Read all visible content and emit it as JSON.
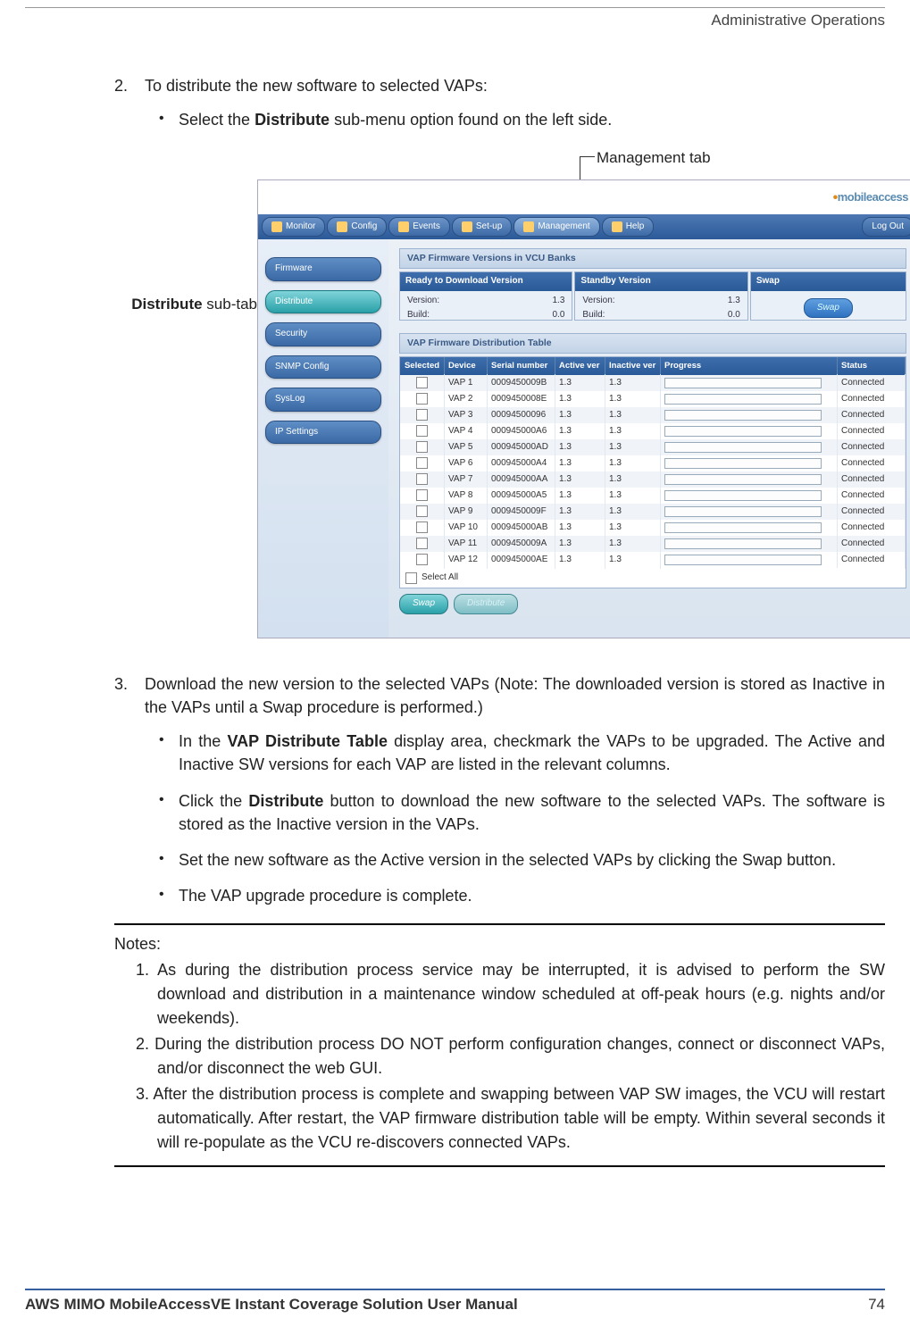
{
  "header": {
    "section": "Administrative Operations"
  },
  "steps": {
    "s2_num": "2.",
    "s2_text": "To distribute the new software to selected VAPs:",
    "s2_b1_pre": "Select the ",
    "s2_b1_bold": "Distribute",
    "s2_b1_post": " sub-menu option found on the left side.",
    "s3_num": "3.",
    "s3_text": "Download the new version to the selected VAPs (Note: The downloaded version is stored as Inactive in the VAPs until a Swap procedure is performed.)",
    "s3_b1_pre": "In the ",
    "s3_b1_bold": "VAP Distribute Table",
    "s3_b1_post": " display area, checkmark the VAPs to be upgraded.  The Active and Inactive SW versions for each VAP are listed in the relevant columns.",
    "s3_b2_pre": "Click the ",
    "s3_b2_bold": "Distribute",
    "s3_b2_post": " button to download the new software to the selected VAPs. The software is stored as the Inactive version in the VAPs.",
    "s3_b3": "Set the new software as the Active version in the selected VAPs by clicking the Swap button.",
    "s3_b4": "The VAP upgrade procedure is complete."
  },
  "callouts": {
    "management": "Management tab",
    "distribute_pre": "Distribute",
    "distribute_post": " sub-tab"
  },
  "screenshot": {
    "logo": "mobileaccess",
    "menu": [
      "Monitor",
      "Config",
      "Events",
      "Set-up",
      "Management",
      "Help"
    ],
    "logout": "Log Out",
    "sidebar": [
      "Firmware",
      "Distribute",
      "Security",
      "SNMP Config",
      "SysLog",
      "IP Settings"
    ],
    "panel1_title": "VAP Firmware Versions in VCU Banks",
    "bank_ready": "Ready to Download Version",
    "bank_standby": "Standby Version",
    "bank_swap": "Swap",
    "lbl_version": "Version:",
    "lbl_build": "Build:",
    "val_version": "1.3",
    "val_build": "0.0",
    "swap_btn": "Swap",
    "panel2_title": "VAP Firmware Distribution Table",
    "columns": [
      "Selected",
      "Device",
      "Serial number",
      "Active ver",
      "Inactive ver",
      "Progress",
      "Status"
    ],
    "rows": [
      {
        "device": "VAP 1",
        "serial": "0009450009B",
        "active": "1.3",
        "inactive": "1.3",
        "status": "Connected"
      },
      {
        "device": "VAP 2",
        "serial": "0009450008E",
        "active": "1.3",
        "inactive": "1.3",
        "status": "Connected"
      },
      {
        "device": "VAP 3",
        "serial": "00094500096",
        "active": "1.3",
        "inactive": "1.3",
        "status": "Connected"
      },
      {
        "device": "VAP 4",
        "serial": "000945000A6",
        "active": "1.3",
        "inactive": "1.3",
        "status": "Connected"
      },
      {
        "device": "VAP 5",
        "serial": "000945000AD",
        "active": "1.3",
        "inactive": "1.3",
        "status": "Connected"
      },
      {
        "device": "VAP 6",
        "serial": "000945000A4",
        "active": "1.3",
        "inactive": "1.3",
        "status": "Connected"
      },
      {
        "device": "VAP 7",
        "serial": "000945000AA",
        "active": "1.3",
        "inactive": "1.3",
        "status": "Connected"
      },
      {
        "device": "VAP 8",
        "serial": "000945000A5",
        "active": "1.3",
        "inactive": "1.3",
        "status": "Connected"
      },
      {
        "device": "VAP 9",
        "serial": "0009450009F",
        "active": "1.3",
        "inactive": "1.3",
        "status": "Connected"
      },
      {
        "device": "VAP 10",
        "serial": "000945000AB",
        "active": "1.3",
        "inactive": "1.3",
        "status": "Connected"
      },
      {
        "device": "VAP 11",
        "serial": "0009450009A",
        "active": "1.3",
        "inactive": "1.3",
        "status": "Connected"
      },
      {
        "device": "VAP 12",
        "serial": "000945000AE",
        "active": "1.3",
        "inactive": "1.3",
        "status": "Connected"
      }
    ],
    "select_all": "Select All",
    "btn_swap": "Swap",
    "btn_distribute": "Distribute"
  },
  "notes": {
    "title": "Notes:",
    "n1": "1. As during the distribution process service may be interrupted, it is advised to perform the SW download and distribution in a maintenance window scheduled at off-peak hours (e.g. nights and/or weekends).",
    "n2": "2. During the distribution process DO NOT perform configuration changes, connect or disconnect VAPs, and/or disconnect the web GUI.",
    "n3": "3. After the distribution process is complete and swapping between VAP SW images, the VCU will restart automatically. After restart, the VAP firmware distribution table will be empty. Within several seconds it will re-populate as the VCU re-discovers connected VAPs."
  },
  "footer": {
    "title": "AWS MIMO MobileAccessVE Instant Coverage Solution User Manual",
    "page": "74"
  }
}
